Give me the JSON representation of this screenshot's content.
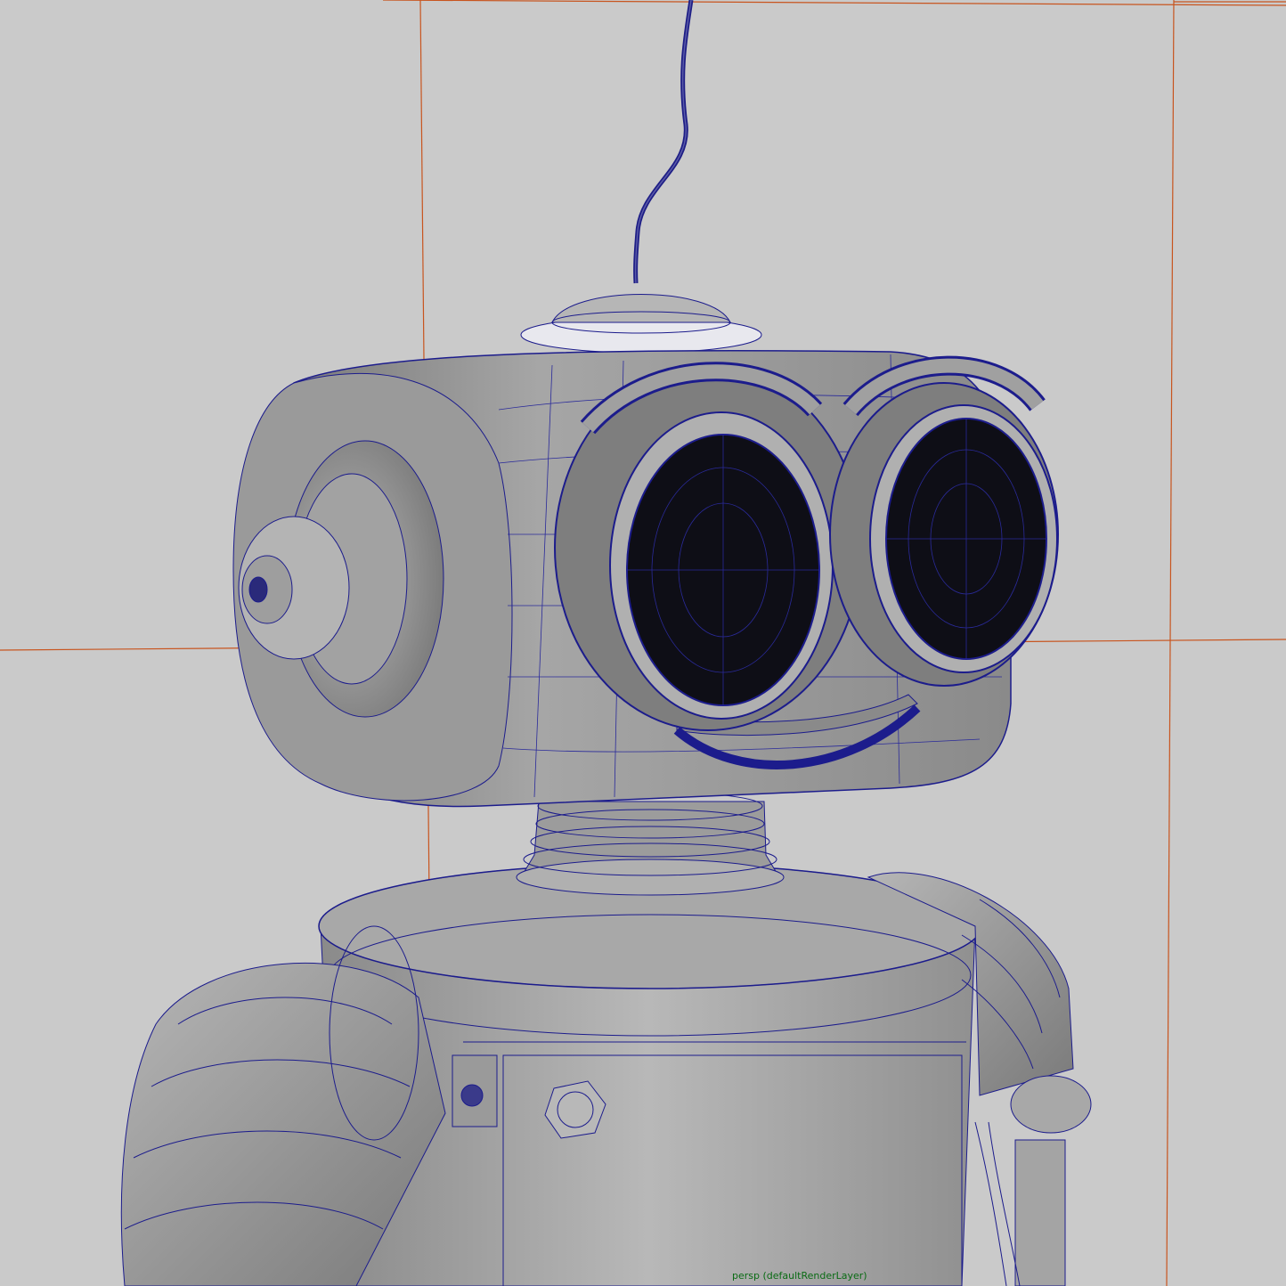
{
  "viewport": {
    "camera_label": "persp (defaultRenderLayer)",
    "colors": {
      "background": "#cacaca",
      "grid": "#c8541e",
      "wireframe": "#1c1c8c",
      "surface": "#8c8c8c",
      "surface_light": "#b4b4b4",
      "eye_glass": "#0d0d14",
      "label": "#0a6b14"
    }
  }
}
